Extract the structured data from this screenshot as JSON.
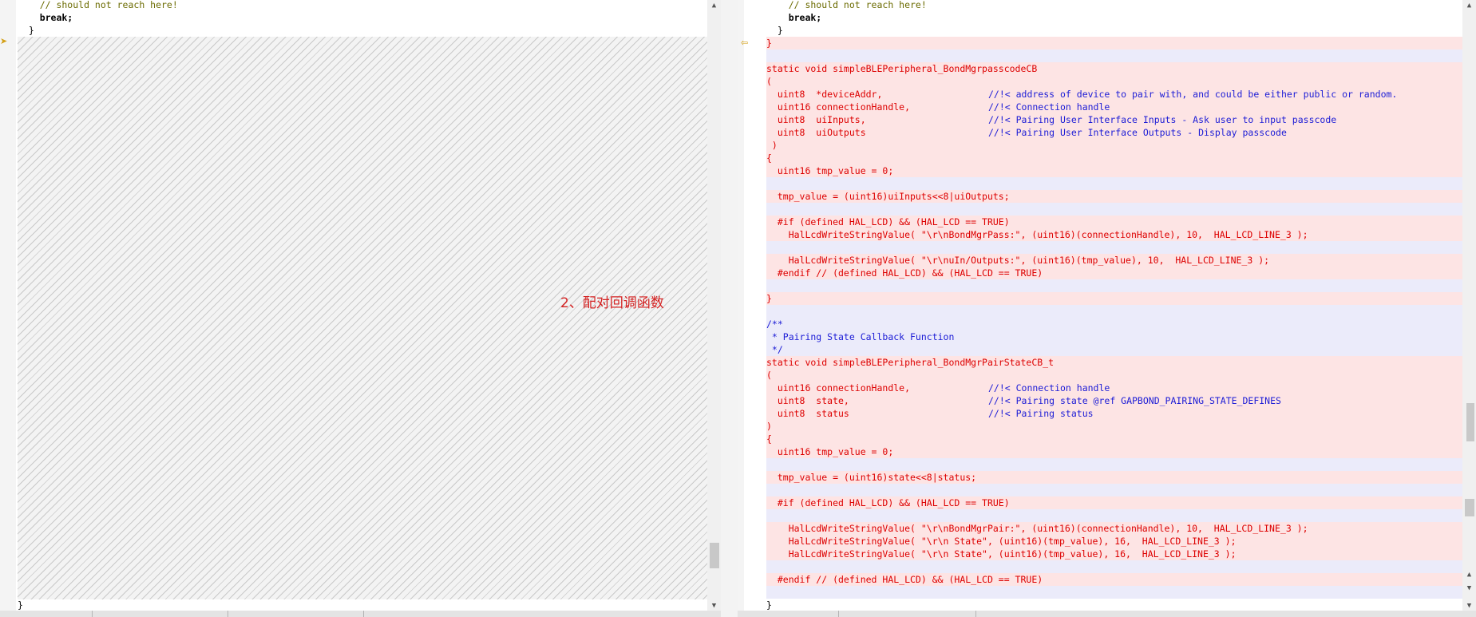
{
  "annotation": "2、配对回调函数",
  "left": {
    "lines": [
      {
        "text": "    // should not reach here!",
        "cls": "comment"
      },
      {
        "text": "    break;",
        "cls": "kw"
      },
      {
        "text": "  }",
        "cls": "black"
      }
    ],
    "closing_brace": "}"
  },
  "right": {
    "lines": [
      {
        "text": "    // should not reach here!",
        "cls": "comment",
        "bg": ""
      },
      {
        "text": "    break;",
        "cls": "kw",
        "bg": ""
      },
      {
        "text": "  }",
        "cls": "black",
        "bg": ""
      },
      {
        "text": "}",
        "cls": "red",
        "bg": "bg-pink"
      },
      {
        "text": "",
        "cls": "red",
        "bg": "bg-lav"
      },
      {
        "text": "static void simpleBLEPeripheral_BondMgrpasscodeCB",
        "cls": "red",
        "bg": "bg-pink"
      },
      {
        "text": "(",
        "cls": "red",
        "bg": "bg-pink"
      },
      {
        "text": "  uint8  *deviceAddr,",
        "cls": "red",
        "bg": "bg-pink",
        "comment": "//!< address of device to pair with, and could be either public or random."
      },
      {
        "text": "  uint16 connectionHandle,",
        "cls": "red",
        "bg": "bg-pink",
        "comment": "//!< Connection handle"
      },
      {
        "text": "  uint8  uiInputs,",
        "cls": "red",
        "bg": "bg-pink",
        "comment": "//!< Pairing User Interface Inputs - Ask user to input passcode"
      },
      {
        "text": "  uint8  uiOutputs",
        "cls": "red",
        "bg": "bg-pink",
        "comment": "//!< Pairing User Interface Outputs - Display passcode"
      },
      {
        "text": " )",
        "cls": "red",
        "bg": "bg-pink"
      },
      {
        "text": "{",
        "cls": "red",
        "bg": "bg-pink"
      },
      {
        "text": "  uint16 tmp_value = 0;",
        "cls": "red",
        "bg": "bg-pink"
      },
      {
        "text": "",
        "cls": "red",
        "bg": "bg-lav"
      },
      {
        "text": "  tmp_value = (uint16)uiInputs<<8|uiOutputs;",
        "cls": "red",
        "bg": "bg-pink"
      },
      {
        "text": "",
        "cls": "red",
        "bg": "bg-lav"
      },
      {
        "text": "  #if (defined HAL_LCD) && (HAL_LCD == TRUE)",
        "cls": "red",
        "bg": "bg-pink"
      },
      {
        "text": "    HalLcdWriteStringValue( \"\\r\\nBondMgrPass:\", (uint16)(connectionHandle), 10,  HAL_LCD_LINE_3 );",
        "cls": "red",
        "bg": "bg-pink"
      },
      {
        "text": "",
        "cls": "red",
        "bg": "bg-lav"
      },
      {
        "text": "    HalLcdWriteStringValue( \"\\r\\nuIn/Outputs:\", (uint16)(tmp_value), 10,  HAL_LCD_LINE_3 );",
        "cls": "red",
        "bg": "bg-pink"
      },
      {
        "text": "  #endif // (defined HAL_LCD) && (HAL_LCD == TRUE)",
        "cls": "red",
        "bg": "bg-pink"
      },
      {
        "text": "",
        "cls": "red",
        "bg": "bg-lav"
      },
      {
        "text": "}",
        "cls": "red",
        "bg": "bg-pink"
      },
      {
        "text": "",
        "cls": "red",
        "bg": "bg-lav"
      },
      {
        "text": "/**",
        "cls": "blue",
        "bg": "bg-lav"
      },
      {
        "text": " * Pairing State Callback Function",
        "cls": "blue",
        "bg": "bg-lav"
      },
      {
        "text": " */",
        "cls": "blue",
        "bg": "bg-lav"
      },
      {
        "text": "static void simpleBLEPeripheral_BondMgrPairStateCB_t",
        "cls": "red",
        "bg": "bg-pink"
      },
      {
        "text": "(",
        "cls": "red",
        "bg": "bg-pink"
      },
      {
        "text": "  uint16 connectionHandle,",
        "cls": "red",
        "bg": "bg-pink",
        "comment": "//!< Connection handle"
      },
      {
        "text": "  uint8  state,",
        "cls": "red",
        "bg": "bg-pink",
        "comment": "//!< Pairing state @ref GAPBOND_PAIRING_STATE_DEFINES"
      },
      {
        "text": "  uint8  status",
        "cls": "red",
        "bg": "bg-pink",
        "comment": "//!< Pairing status"
      },
      {
        "text": ")",
        "cls": "red",
        "bg": "bg-pink"
      },
      {
        "text": "{",
        "cls": "red",
        "bg": "bg-pink"
      },
      {
        "text": "  uint16 tmp_value = 0;",
        "cls": "red",
        "bg": "bg-pink"
      },
      {
        "text": "",
        "cls": "red",
        "bg": "bg-lav"
      },
      {
        "text": "  tmp_value = (uint16)state<<8|status;",
        "cls": "red",
        "bg": "bg-pink"
      },
      {
        "text": "",
        "cls": "red",
        "bg": "bg-lav"
      },
      {
        "text": "  #if (defined HAL_LCD) && (HAL_LCD == TRUE)",
        "cls": "red",
        "bg": "bg-pink"
      },
      {
        "text": "",
        "cls": "red",
        "bg": "bg-lav"
      },
      {
        "text": "    HalLcdWriteStringValue( \"\\r\\nBondMgrPair:\", (uint16)(connectionHandle), 10,  HAL_LCD_LINE_3 );",
        "cls": "red",
        "bg": "bg-pink"
      },
      {
        "text": "    HalLcdWriteStringValue( \"\\r\\n State\", (uint16)(tmp_value), 16,  HAL_LCD_LINE_3 );",
        "cls": "red",
        "bg": "bg-pink"
      },
      {
        "text": "    HalLcdWriteStringValue( \"\\r\\n State\", (uint16)(tmp_value), 16,  HAL_LCD_LINE_3 );",
        "cls": "red",
        "bg": "bg-pink"
      },
      {
        "text": "",
        "cls": "red",
        "bg": "bg-lav"
      },
      {
        "text": "  #endif // (defined HAL_LCD) && (HAL_LCD == TRUE)",
        "cls": "red",
        "bg": "bg-pink"
      },
      {
        "text": "",
        "cls": "red",
        "bg": "bg-lav"
      },
      {
        "text": "}",
        "cls": "black",
        "bg": ""
      }
    ]
  },
  "icons": {
    "scroll_up": "chevron-up-icon",
    "scroll_down": "chevron-down-icon",
    "diff_marker": "arrow-left-icon"
  },
  "colors": {
    "diff_removed_bg": "#fde4e4",
    "diff_gap_bg": "#ebebfa",
    "code_red": "#d00000",
    "comment_blue": "#1c1cd6",
    "annotation_red": "#d42020"
  }
}
